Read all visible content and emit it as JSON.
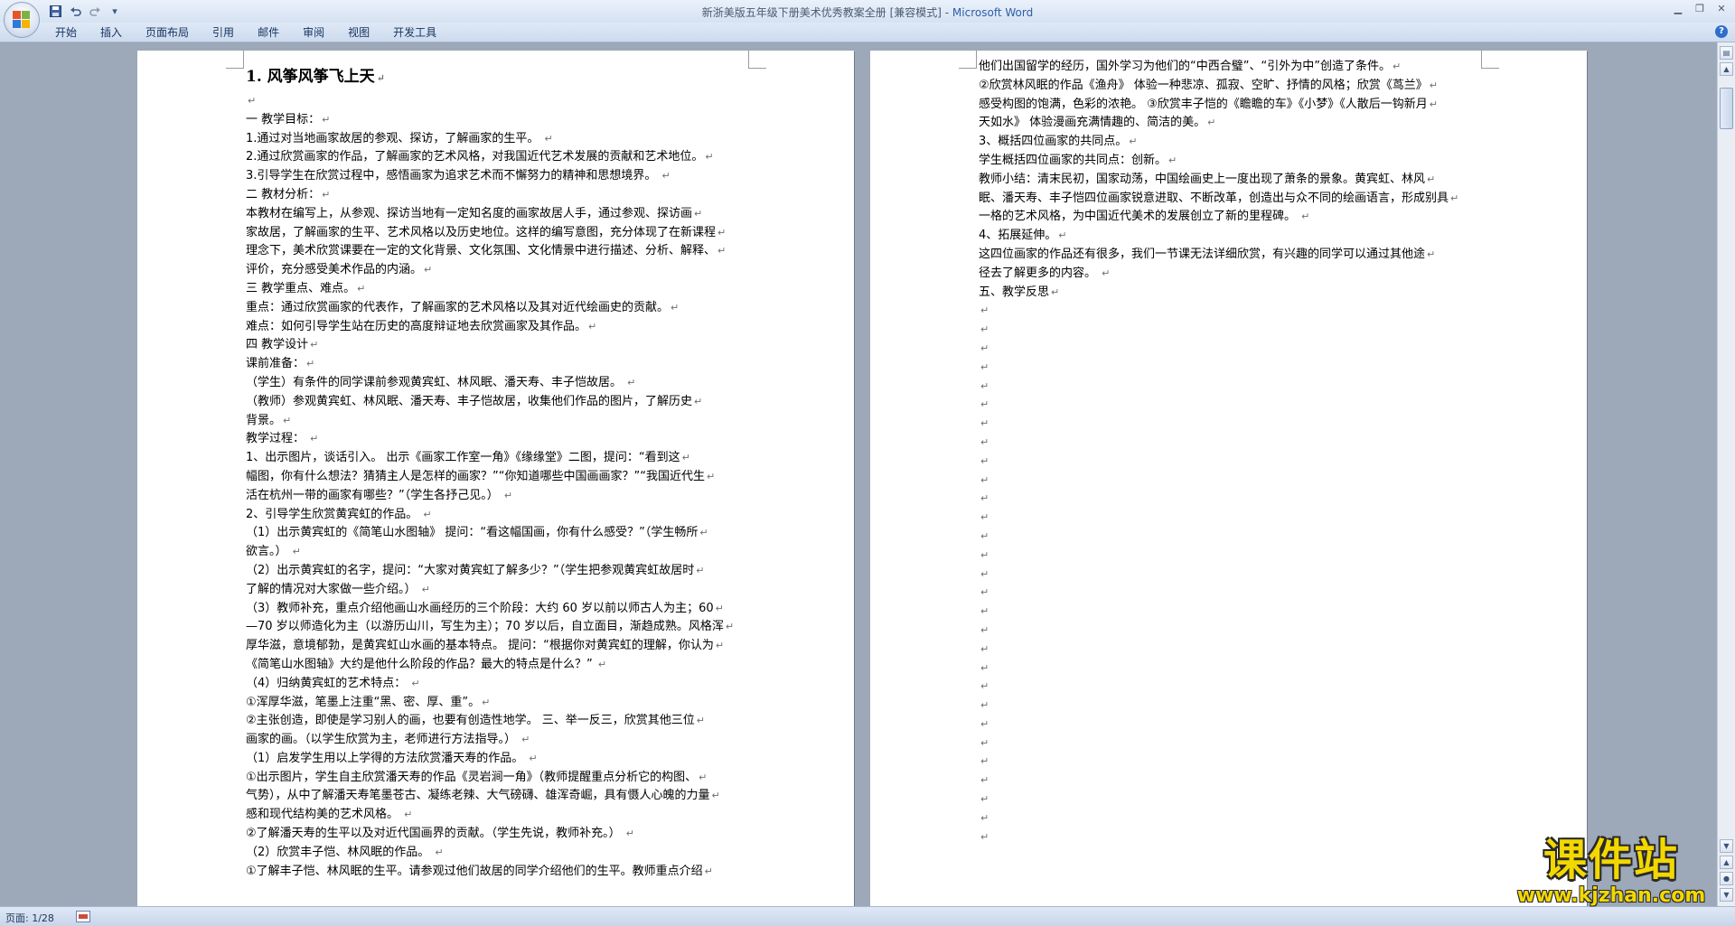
{
  "window": {
    "title": "新浙美版五年级下册美术优秀教案全册 [兼容模式] - ",
    "app_name": "Microsoft Word"
  },
  "quick_access": {
    "save": "save-icon",
    "undo": "undo-icon",
    "redo": "redo-icon",
    "customize": "▾"
  },
  "ribbon": {
    "tabs": [
      "开始",
      "插入",
      "页面布局",
      "引用",
      "邮件",
      "审阅",
      "视图",
      "开发工具"
    ]
  },
  "paragraph_mark": "↵",
  "pages": {
    "left": [
      {
        "style": "h1",
        "text": "1.  风筝风筝飞上天"
      },
      {
        "style": "p",
        "text": ""
      },
      {
        "style": "p",
        "text": "一 教学目标："
      },
      {
        "style": "p",
        "text": "    1.通过对当地画家故居的参观、探访，了解画家的生平。 "
      },
      {
        "style": "p",
        "text": "    2.通过欣赏画家的作品，了解画家的艺术风格，对我国近代艺术发展的贡献和艺术地位。"
      },
      {
        "style": "p",
        "text": "    3.引导学生在欣赏过程中，感悟画家为追求艺术而不懈努力的精神和思想境界。 "
      },
      {
        "style": "p",
        "text": "二 教材分析："
      },
      {
        "style": "p",
        "text": "    本教材在编写上，从参观、探访当地有一定知名度的画家故居人手，通过参观、探访画"
      },
      {
        "style": "p",
        "text": "家故居，了解画家的生平、艺术风格以及历史地位。这样的编写意图，充分体现了在新课程"
      },
      {
        "style": "p",
        "text": "理念下，美术欣赏课要在一定的文化背景、文化氛围、文化情景中进行描述、分析、解释、"
      },
      {
        "style": "p",
        "text": "评价，充分感受美术作品的内涵。"
      },
      {
        "style": "p",
        "text": "三 教学重点、难点。"
      },
      {
        "style": "p",
        "text": "     重点：通过欣赏画家的代表作，了解画家的艺术风格以及其对近代绘画史的贡献。"
      },
      {
        "style": "p",
        "text": "     难点：如何引导学生站在历史的高度辩证地去欣赏画家及其作品。"
      },
      {
        "style": "p",
        "text": "四 教学设计"
      },
      {
        "style": "p",
        "text": "课前准备："
      },
      {
        "style": "p",
        "text": "    （学生）有条件的同学课前参观黄宾虹、林风眠、潘天寿、丰子恺故居。 "
      },
      {
        "style": "p",
        "text": "    （教师）参观黄宾虹、林风眠、潘天寿、丰子恺故居，收集他们作品的图片，了解历史"
      },
      {
        "style": "p",
        "text": "背景。"
      },
      {
        "style": "p",
        "text": " 教学过程： "
      },
      {
        "style": "p",
        "text": "    1、出示图片，谈话引入。 出示《画家工作室一角》《缘缘堂》二图，提问：“看到这"
      },
      {
        "style": "p",
        "text": "幅图，你有什么想法？猜猜主人是怎样的画家？”“你知道哪些中国画画家？”“我国近代生"
      },
      {
        "style": "p",
        "text": "活在杭州一带的画家有哪些？”（学生各抒己见。） "
      },
      {
        "style": "p",
        "text": "    2、引导学生欣赏黄宾虹的作品。 "
      },
      {
        "style": "p",
        "text": "  （1）出示黄宾虹的《简笔山水图轴》 提问：“看这幅国画，你有什么感受？”（学生畅所"
      },
      {
        "style": "p",
        "text": "欲言。） "
      },
      {
        "style": "p",
        "text": "  （2）出示黄宾虹的名字，提问：“大家对黄宾虹了解多少？”（学生把参观黄宾虹故居时"
      },
      {
        "style": "p",
        "text": "了解的情况对大家做一些介绍。） "
      },
      {
        "style": "p",
        "text": "  （3）教师补充，重点介绍他画山水画经历的三个阶段：大约 60 岁以前以师古人为主；60"
      },
      {
        "style": "p",
        "text": "—70 岁以师造化为主（以游历山川，写生为主）；70 岁以后，自立面目，渐趋成熟。风格浑"
      },
      {
        "style": "p",
        "text": "厚华滋，意境郁勃，是黄宾虹山水画的基本特点。 提问：“根据你对黄宾虹的理解，你认为"
      },
      {
        "style": "p",
        "text": "《简笔山水图轴》大约是他什么阶段的作品？最大的特点是什么？” "
      },
      {
        "style": "p",
        "text": "   （4）归纳黄宾虹的艺术特点： "
      },
      {
        "style": "p",
        "text": "    ①浑厚华滋，笔墨上注重“黑、密、厚、重”。"
      },
      {
        "style": "p",
        "text": "    ②主张创造，即使是学习别人的画，也要有创造性地学。 三、举一反三，欣赏其他三位"
      },
      {
        "style": "p",
        "text": "画家的画。（以学生欣赏为主，老师进行方法指导。） "
      },
      {
        "style": "p",
        "text": "  （1）启发学生用以上学得的方法欣赏潘天寿的作品。 "
      },
      {
        "style": "p",
        "text": "    ①出示图片，学生自主欣赏潘天寿的作品《灵岩涧一角》（教师提醒重点分析它的构图、"
      },
      {
        "style": "p",
        "text": "气势），从中了解潘天寿笔墨苍古、凝练老辣、大气磅礴、雄浑奇崛，具有慑人心魄的力量"
      },
      {
        "style": "p",
        "text": "感和现代结构美的艺术风格。 "
      },
      {
        "style": "p",
        "text": "    ②了解潘天寿的生平以及对近代国画界的贡献。（学生先说，教师补充。） "
      },
      {
        "style": "p",
        "text": "   （2）欣赏丰子恺、林风眠的作品。 "
      },
      {
        "style": "p",
        "text": "  ①了解丰子恺、林风眠的生平。请参观过他们故居的同学介绍他们的生平。教师重点介绍"
      }
    ],
    "right": [
      {
        "style": "p",
        "text": "他们出国留学的经历，国外学习为他们的“中西合璧”、“引外为中”创造了条件。"
      },
      {
        "style": "p",
        "text": "   ②欣赏林风眠的作品《渔舟》 体验一种悲凉、孤寂、空旷、抒情的风格；欣赏《茑兰》"
      },
      {
        "style": "p",
        "text": "感受构图的饱满，色彩的浓艳。 ③欣赏丰子恺的《瞻瞻的车》《小梦》《人散后一钩新月"
      },
      {
        "style": "p",
        "text": "天如水》 体验漫画充满情趣的、简洁的美。"
      },
      {
        "style": "p",
        "text": "   3、概括四位画家的共同点。"
      },
      {
        "style": "p",
        "text": "   学生概括四位画家的共同点：创新。"
      },
      {
        "style": "p",
        "text": "   教师小结：清末民初，国家动荡，中国绘画史上一度出现了萧条的景象。黄宾虹、林风"
      },
      {
        "style": "p",
        "text": "眠、潘天寿、丰子恺四位画家锐意进取、不断改革，创造出与众不同的绘画语言，形成别具"
      },
      {
        "style": "p",
        "text": "一格的艺术风格，为中国近代美术的发展创立了新的里程碑。 "
      },
      {
        "style": "p",
        "text": "  4、拓展延伸。"
      },
      {
        "style": "p",
        "text": "    这四位画家的作品还有很多，我们一节课无法详细欣赏，有兴趣的同学可以通过其他途"
      },
      {
        "style": "p",
        "text": "径去了解更多的内容。       "
      },
      {
        "style": "p",
        "text": "五、教学反思"
      },
      {
        "style": "p",
        "text": ""
      },
      {
        "style": "p",
        "text": ""
      },
      {
        "style": "p",
        "text": ""
      },
      {
        "style": "p",
        "text": ""
      },
      {
        "style": "p",
        "text": ""
      },
      {
        "style": "p",
        "text": ""
      },
      {
        "style": "p",
        "text": ""
      },
      {
        "style": "p",
        "text": ""
      },
      {
        "style": "p",
        "text": ""
      },
      {
        "style": "p",
        "text": ""
      },
      {
        "style": "p",
        "text": ""
      },
      {
        "style": "p",
        "text": ""
      },
      {
        "style": "p",
        "text": ""
      },
      {
        "style": "p",
        "text": ""
      },
      {
        "style": "p",
        "text": ""
      },
      {
        "style": "p",
        "text": ""
      },
      {
        "style": "p",
        "text": ""
      },
      {
        "style": "p",
        "text": ""
      },
      {
        "style": "p",
        "text": ""
      },
      {
        "style": "p",
        "text": ""
      },
      {
        "style": "p",
        "text": ""
      },
      {
        "style": "p",
        "text": ""
      },
      {
        "style": "p",
        "text": ""
      },
      {
        "style": "p",
        "text": ""
      },
      {
        "style": "p",
        "text": ""
      },
      {
        "style": "p",
        "text": ""
      },
      {
        "style": "p",
        "text": ""
      },
      {
        "style": "p",
        "text": ""
      },
      {
        "style": "p",
        "text": ""
      }
    ]
  },
  "status": {
    "page": "页面: 1/28"
  },
  "watermark": {
    "main": "课件站",
    "url": "www.kjzhan.com"
  }
}
